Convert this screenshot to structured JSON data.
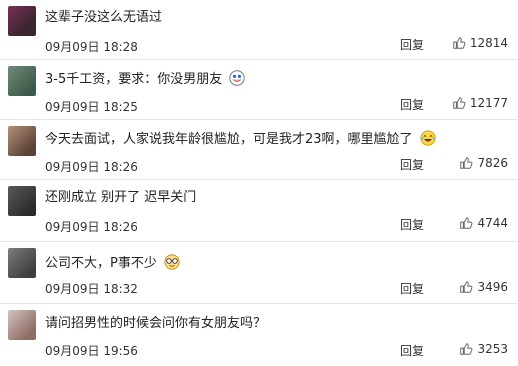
{
  "comments": [
    {
      "text": "这辈子没这么无语过",
      "time": "09月09日 18:28",
      "reply": "回复",
      "likes": "12814",
      "emoji": ""
    },
    {
      "text": "3-5千工资，要求：你没男朋友",
      "time": "09月09日 18:25",
      "reply": "回复",
      "likes": "12177",
      "emoji": "smile-emoji"
    },
    {
      "text": "今天去面试，人家说我年龄很尴尬，可是我才23啊，哪里尴尬了",
      "time": "09月09日 18:26",
      "reply": "回复",
      "likes": "7826",
      "emoji": "laugh-emoji"
    },
    {
      "text": "还刚成立 别开了 迟早关门",
      "time": "09月09日 18:26",
      "reply": "回复",
      "likes": "4744",
      "emoji": ""
    },
    {
      "text": "公司不大，P事不少",
      "time": "09月09日 18:32",
      "reply": "回复",
      "likes": "3496",
      "emoji": "glasses-emoji"
    },
    {
      "text": "请问招男性的时候会问你有女朋友吗？",
      "time": "09月09日 19:56",
      "reply": "回复",
      "likes": "3253",
      "emoji": ""
    }
  ],
  "icons": {
    "like": "thumbs-up-icon"
  }
}
